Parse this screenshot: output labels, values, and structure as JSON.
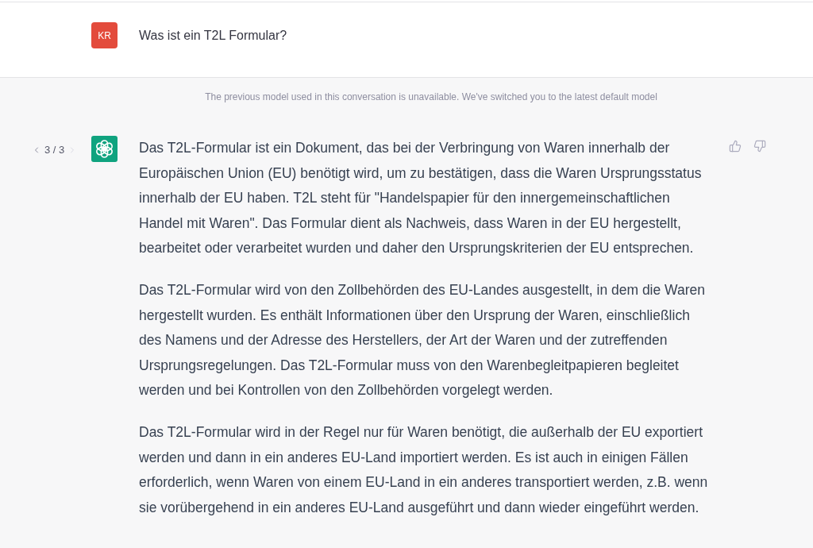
{
  "user_message": {
    "avatar": "KR",
    "text": "Was ist ein T2L Formular?"
  },
  "notice": "The previous model used in this conversation is unavailable. We've switched you to the latest default model",
  "assistant_message": {
    "pagination": {
      "label": "3 / 3",
      "prev_disabled": false,
      "next_disabled": true
    },
    "paragraphs": [
      "Das T2L-Formular ist ein Dokument, das bei der Verbringung von Waren innerhalb der Europäischen Union (EU) benötigt wird, um zu bestätigen, dass die Waren Ursprungsstatus innerhalb der EU haben. T2L steht für \"Handelspapier für den innergemeinschaftlichen Handel mit Waren\". Das Formular dient als Nachweis, dass Waren in der EU hergestellt, bearbeitet oder verarbeitet wurden und daher den Ursprungskriterien der EU entsprechen.",
      "Das T2L-Formular wird von den Zollbehörden des EU-Landes ausgestellt, in dem die Waren hergestellt wurden. Es enthält Informationen über den Ursprung der Waren, einschließlich des Namens und der Adresse des Herstellers, der Art der Waren und der zutreffenden Ursprungsregelungen. Das T2L-Formular muss von den Warenbegleitpapieren begleitet werden und bei Kontrollen von den Zollbehörden vorgelegt werden.",
      "Das T2L-Formular wird in der Regel nur für Waren benötigt, die außerhalb der EU exportiert werden und dann in ein anderes EU-Land importiert werden. Es ist auch in einigen Fällen erforderlich, wenn Waren von einem EU-Land in ein anderes transportiert werden, z.B. wenn sie vorübergehend in ein anderes EU-Land ausgeführt und dann wieder eingeführt werden."
    ]
  }
}
